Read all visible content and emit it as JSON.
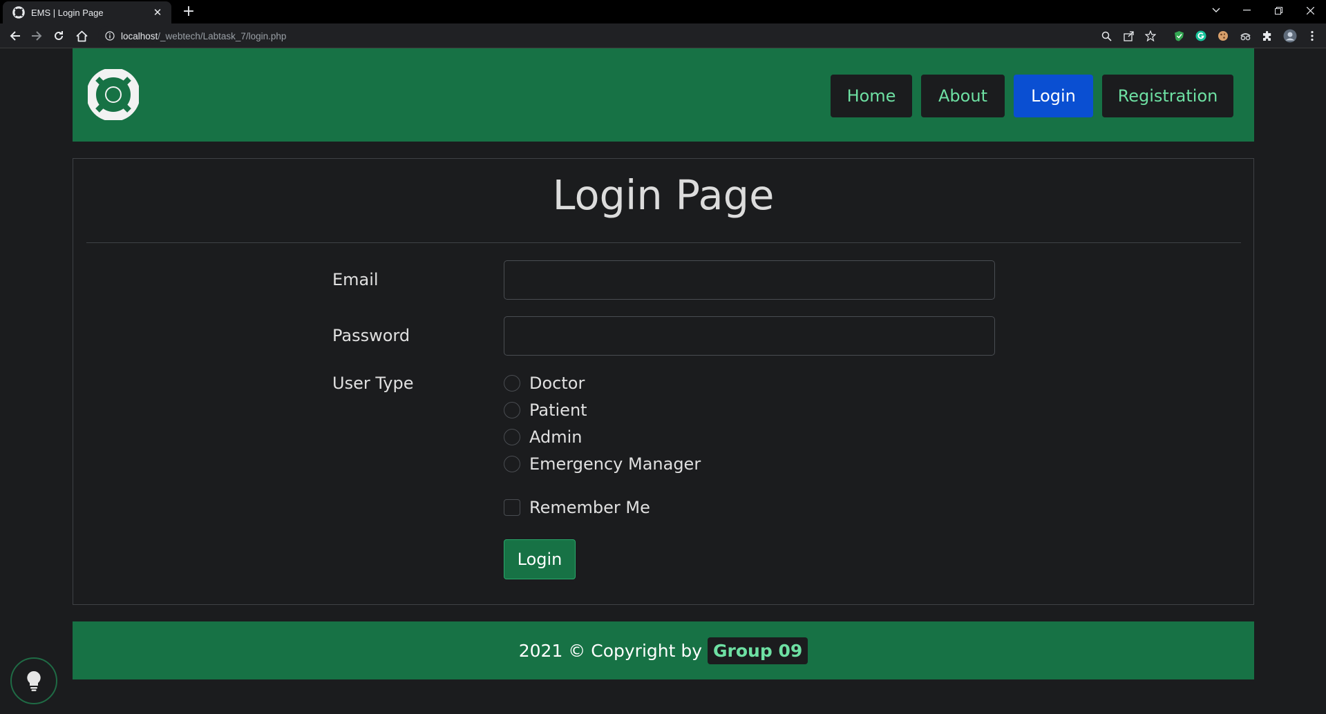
{
  "browser": {
    "tab_title": "EMS | Login Page",
    "tab_close": "✕",
    "new_tab": "+",
    "url_host": "localhost",
    "url_path": "/_webtech/Labtask_7/login.php"
  },
  "nav": {
    "home": "Home",
    "about": "About",
    "login": "Login",
    "registration": "Registration"
  },
  "page": {
    "title": "Login Page"
  },
  "form": {
    "email_label": "Email",
    "email_value": "",
    "password_label": "Password",
    "password_value": "",
    "user_type_label": "User Type",
    "user_types": [
      "Doctor",
      "Patient",
      "Admin",
      "Emergency Manager"
    ],
    "remember_label": "Remember Me",
    "submit_label": "Login"
  },
  "footer": {
    "text": "2021 © Copyright by",
    "badge": "Group 09"
  },
  "colors": {
    "brand_green": "#177245",
    "accent_blue": "#0a4fd2",
    "link_green": "#6ee0a3",
    "background": "#1b1c1e"
  }
}
